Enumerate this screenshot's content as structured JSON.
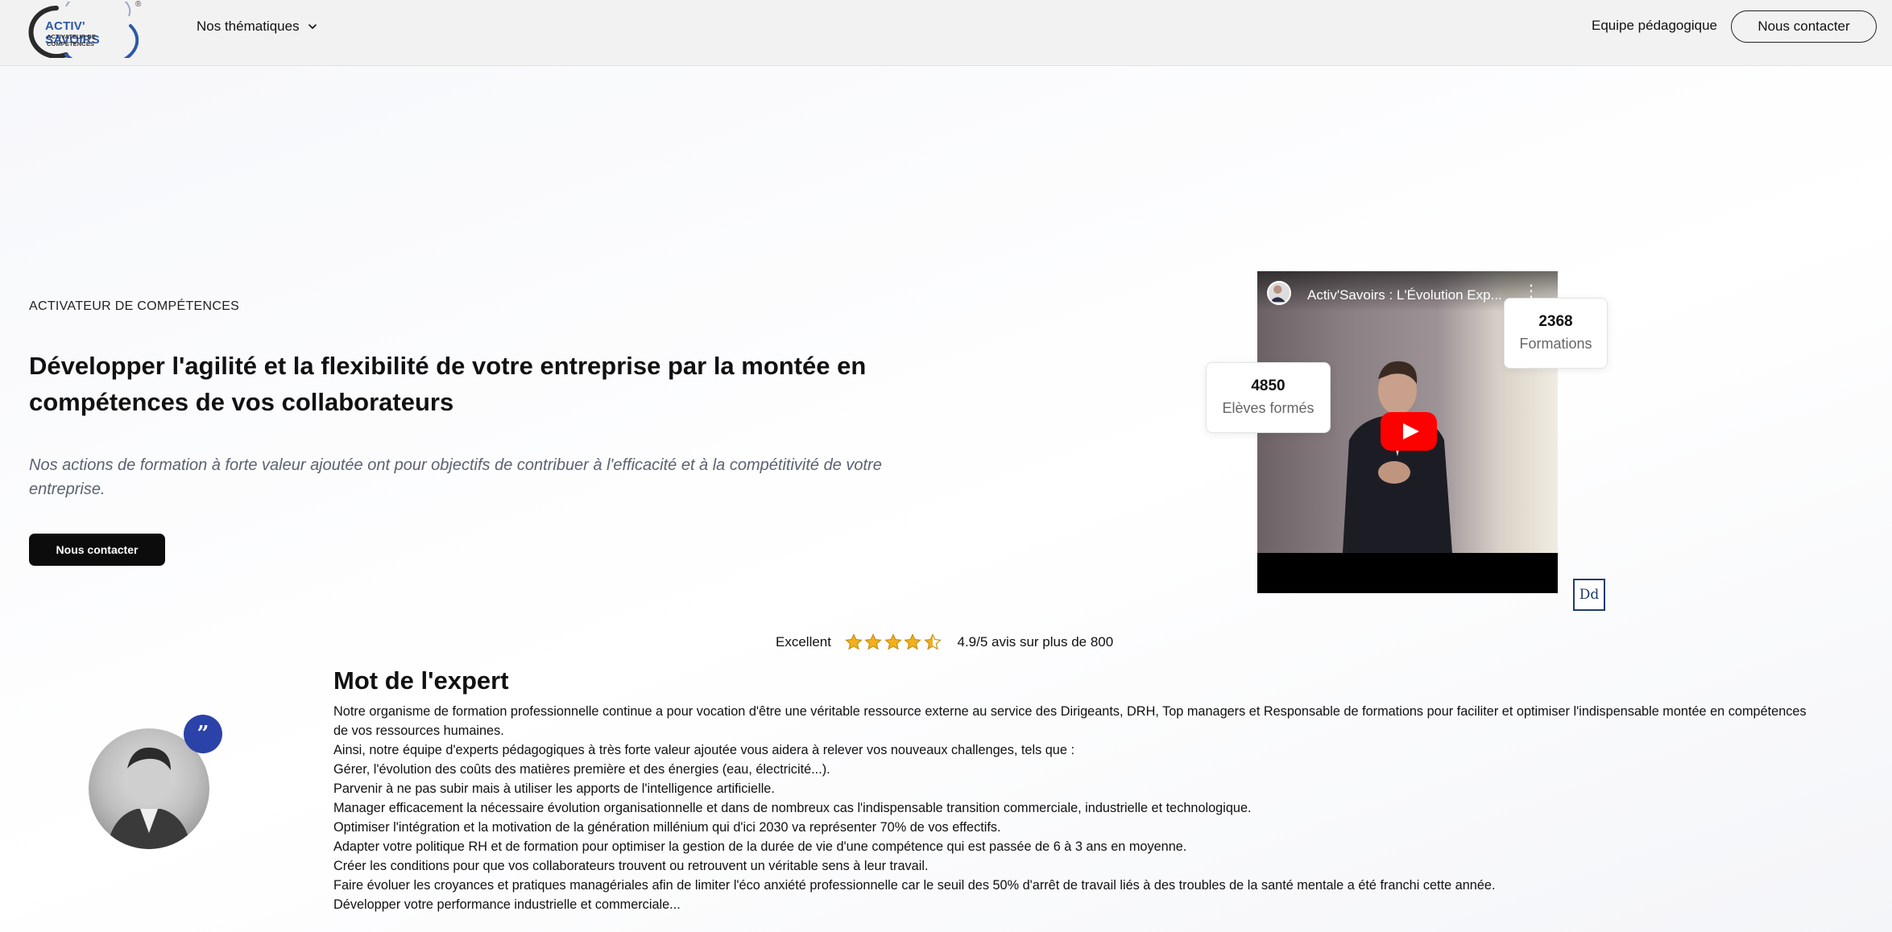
{
  "header": {
    "logo_text": "ACTIV' SAVOIRS",
    "logo_subtext": "ACTIVATEUR DE COMPÉTENCES",
    "logo_mark": "®",
    "nav_dropdown_label": "Nos thématiques",
    "nav_link_label": "Equipe pédagogique",
    "contact_button_label": "Nous contacter"
  },
  "hero": {
    "eyebrow": "ACTIVATEUR DE COMPÉTENCES",
    "title": "Développer l'agilité et la flexibilité de votre entreprise par la montée en compétences de vos collaborateurs",
    "subtitle": "Nos actions de formation à forte valeur ajoutée ont pour objectifs de contribuer à l'efficacité et à la compétitivité de votre entreprise.",
    "cta_label": "Nous contacter"
  },
  "video": {
    "title": "Activ'Savoirs : L'Évolution Exp...",
    "more_icon": "⋮"
  },
  "stats": {
    "formations": {
      "value": "2368",
      "label": "Formations"
    },
    "eleves": {
      "value": "4850",
      "label": "Elèves formés"
    }
  },
  "badge": {
    "text": "Dd"
  },
  "rating": {
    "label": "Excellent",
    "stars_value": 4.5,
    "stars_max": 5,
    "summary": "4.9/5 avis sur plus de 800"
  },
  "expert": {
    "title": "Mot de l'expert",
    "quote_glyph": "”",
    "paragraphs": [
      "Notre organisme de formation professionnelle continue a pour vocation d'être une véritable ressource externe au service des Dirigeants, DRH, Top managers et Responsable de formations pour faciliter et optimiser l'indispensable montée en compétences de vos ressources humaines.",
      "Ainsi, notre équipe d'experts pédagogiques à très forte valeur ajoutée vous aidera à relever vos nouveaux challenges, tels que :",
      "Gérer, l'évolution des coûts des matières première et des énergies (eau, électricité...).",
      "Parvenir à ne pas subir mais à utiliser les apports de l'intelligence artificielle.",
      "Manager efficacement la nécessaire évolution organisationnelle et dans de nombreux cas l'indispensable transition commerciale, industrielle et technologique.",
      "Optimiser l'intégration et la motivation de la génération millénium qui d'ici 2030 va représenter 70% de vos effectifs.",
      "Adapter votre politique RH et de formation pour optimiser la gestion de la durée de vie d'une compétence qui est passée de 6 à 3 ans en moyenne.",
      "Créer les conditions pour que vos collaborateurs trouvent ou retrouvent un véritable sens à leur travail.",
      "Faire évoluer les croyances et pratiques managériales afin de limiter l'éco anxiété professionnelle car le seuil des 50% d'arrêt de travail liés à des troubles de la santé mentale a été franchi cette année.",
      "Développer votre performance industrielle et commerciale..."
    ]
  },
  "colors": {
    "accent_blue": "#2b43a8",
    "logo_blue": "#2c58a8",
    "cta_dark": "#0c0c0c",
    "star_gold": "#f2b01e",
    "youtube_red": "#ff0000"
  }
}
